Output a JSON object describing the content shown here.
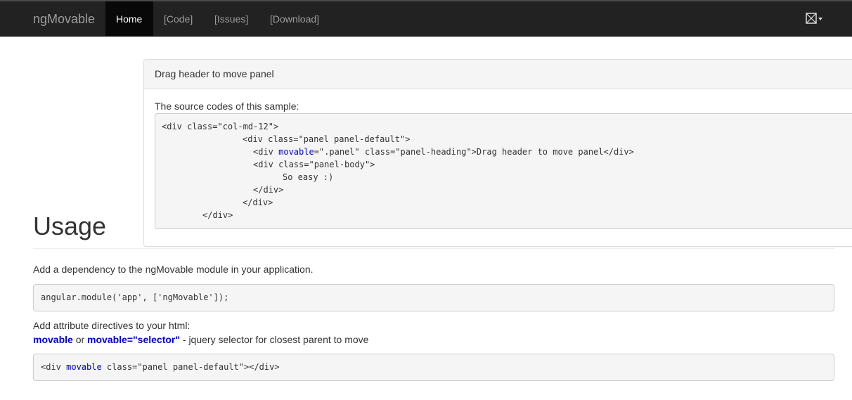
{
  "navbar": {
    "brand": "ngMovable",
    "items": [
      {
        "label": "Home",
        "active": true
      },
      {
        "label": "[Code]"
      },
      {
        "label": "[Issues]"
      },
      {
        "label": "[Download]"
      }
    ],
    "language_icon": "language-flag-icon"
  },
  "panel": {
    "heading": "Drag header to move panel",
    "intro": "The source codes of this sample:",
    "code": {
      "l1": "<div class=\"col-md-12\">",
      "l2": "<div class=\"panel panel-default\">",
      "l3a": "<div ",
      "l3kw": "movable",
      "l3b": "=\".panel\" class=\"panel-heading\">Drag header to move panel</div>",
      "l4": "<div class=\"panel-body\">",
      "l5": "So easy :)",
      "l6": "</div>",
      "l7": "</div>",
      "l8": "</div>"
    }
  },
  "usage": {
    "title": "Usage",
    "dep_text": "Add a dependency to the ngMovable module in your application.",
    "dep_code": "angular.module('app', ['ngMovable']);",
    "attr_text": "Add attribute directives to your html:",
    "attr_kw1": "movable",
    "attr_or": " or ",
    "attr_kw2": "movable=\"selector\"",
    "attr_rest": " - jquery selector for closest parent to move",
    "attr_code_a": "<div ",
    "attr_code_kw": "movable",
    "attr_code_b": " class=\"panel panel-default\"></div>"
  },
  "colors": {
    "navbar_bg": "#222222",
    "keyword": "#0000cc",
    "code_bg": "#f5f5f5"
  }
}
